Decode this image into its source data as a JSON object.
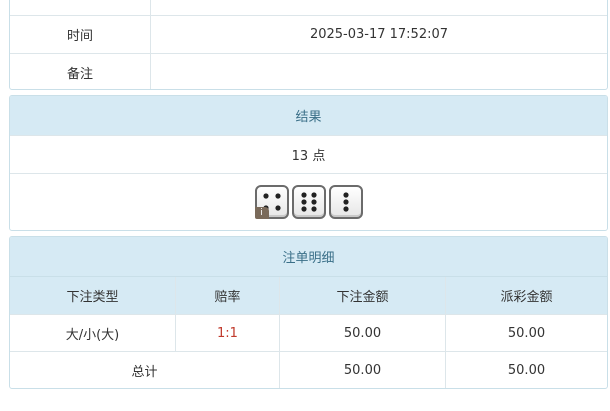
{
  "info": {
    "time_label": "时间",
    "time_value": "2025-03-17 17:52:07",
    "remark_label": "备注",
    "remark_value": ""
  },
  "result": {
    "header": "结果",
    "points": "13 点",
    "dice": [
      4,
      6,
      3
    ],
    "info_badge": "i"
  },
  "details": {
    "header": "注单明细",
    "columns": [
      "下注类型",
      "赔率",
      "下注金额",
      "派彩金额"
    ],
    "rows": [
      {
        "type": "大/小(大)",
        "odds": "1:1",
        "bet": "50.00",
        "payout": "50.00"
      }
    ],
    "total": {
      "label": "总计",
      "bet": "50.00",
      "payout": "50.00"
    }
  }
}
